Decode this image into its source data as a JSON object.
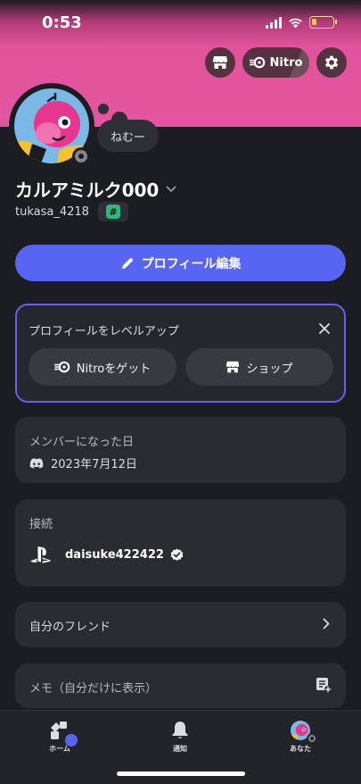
{
  "status_bar": {
    "time": "0:53"
  },
  "header": {
    "nitro_label": "Nitro"
  },
  "profile": {
    "custom_status": "ねむー",
    "display_name": "カルアミルク000",
    "username": "tukasa_4218",
    "badge_symbol": "#"
  },
  "edit_profile": {
    "label": "プロフィール編集"
  },
  "level_up": {
    "title": "プロフィールをレベルアップ",
    "nitro_button": "Nitroをゲット",
    "shop_button": "ショップ"
  },
  "member_since": {
    "label": "メンバーになった日",
    "date": "2023年7月12日"
  },
  "connections": {
    "label": "接続",
    "items": [
      {
        "service_icon": "playstation-icon",
        "name": "daisuke422422",
        "verified": true
      }
    ]
  },
  "friends": {
    "label": "自分のフレンド"
  },
  "memo": {
    "label": "メモ（自分だけに表示）"
  },
  "tab_bar": {
    "home": "ホーム",
    "notifications": "通知",
    "you": "あなた"
  },
  "colors": {
    "banner": "#e3559e",
    "accent": "#5865f2",
    "card": "#2a2c32",
    "background": "#1c1d22",
    "levelup_border": "#6a5ef0"
  }
}
